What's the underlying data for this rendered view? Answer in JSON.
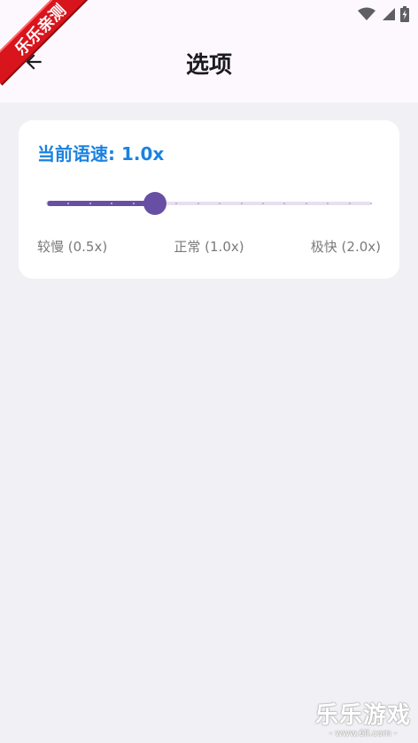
{
  "appbar": {
    "title": "选项"
  },
  "card": {
    "speed_label": "当前语速: 1.0x",
    "slider": {
      "value": 1.0,
      "min": 0.5,
      "max": 2.0,
      "steps": 15
    },
    "labels": {
      "slow": "较慢 (0.5x)",
      "normal": "正常 (1.0x)",
      "fast": "极快 (2.0x)"
    }
  },
  "overlays": {
    "badge": "乐乐亲测",
    "watermark_main": "乐乐游戏",
    "watermark_url": "- www.6ll.com -"
  },
  "colors": {
    "accent": "#6750a4",
    "speed_text": "#1a82e0",
    "track_inactive": "#e8dff0",
    "badge": "#d8141c"
  }
}
